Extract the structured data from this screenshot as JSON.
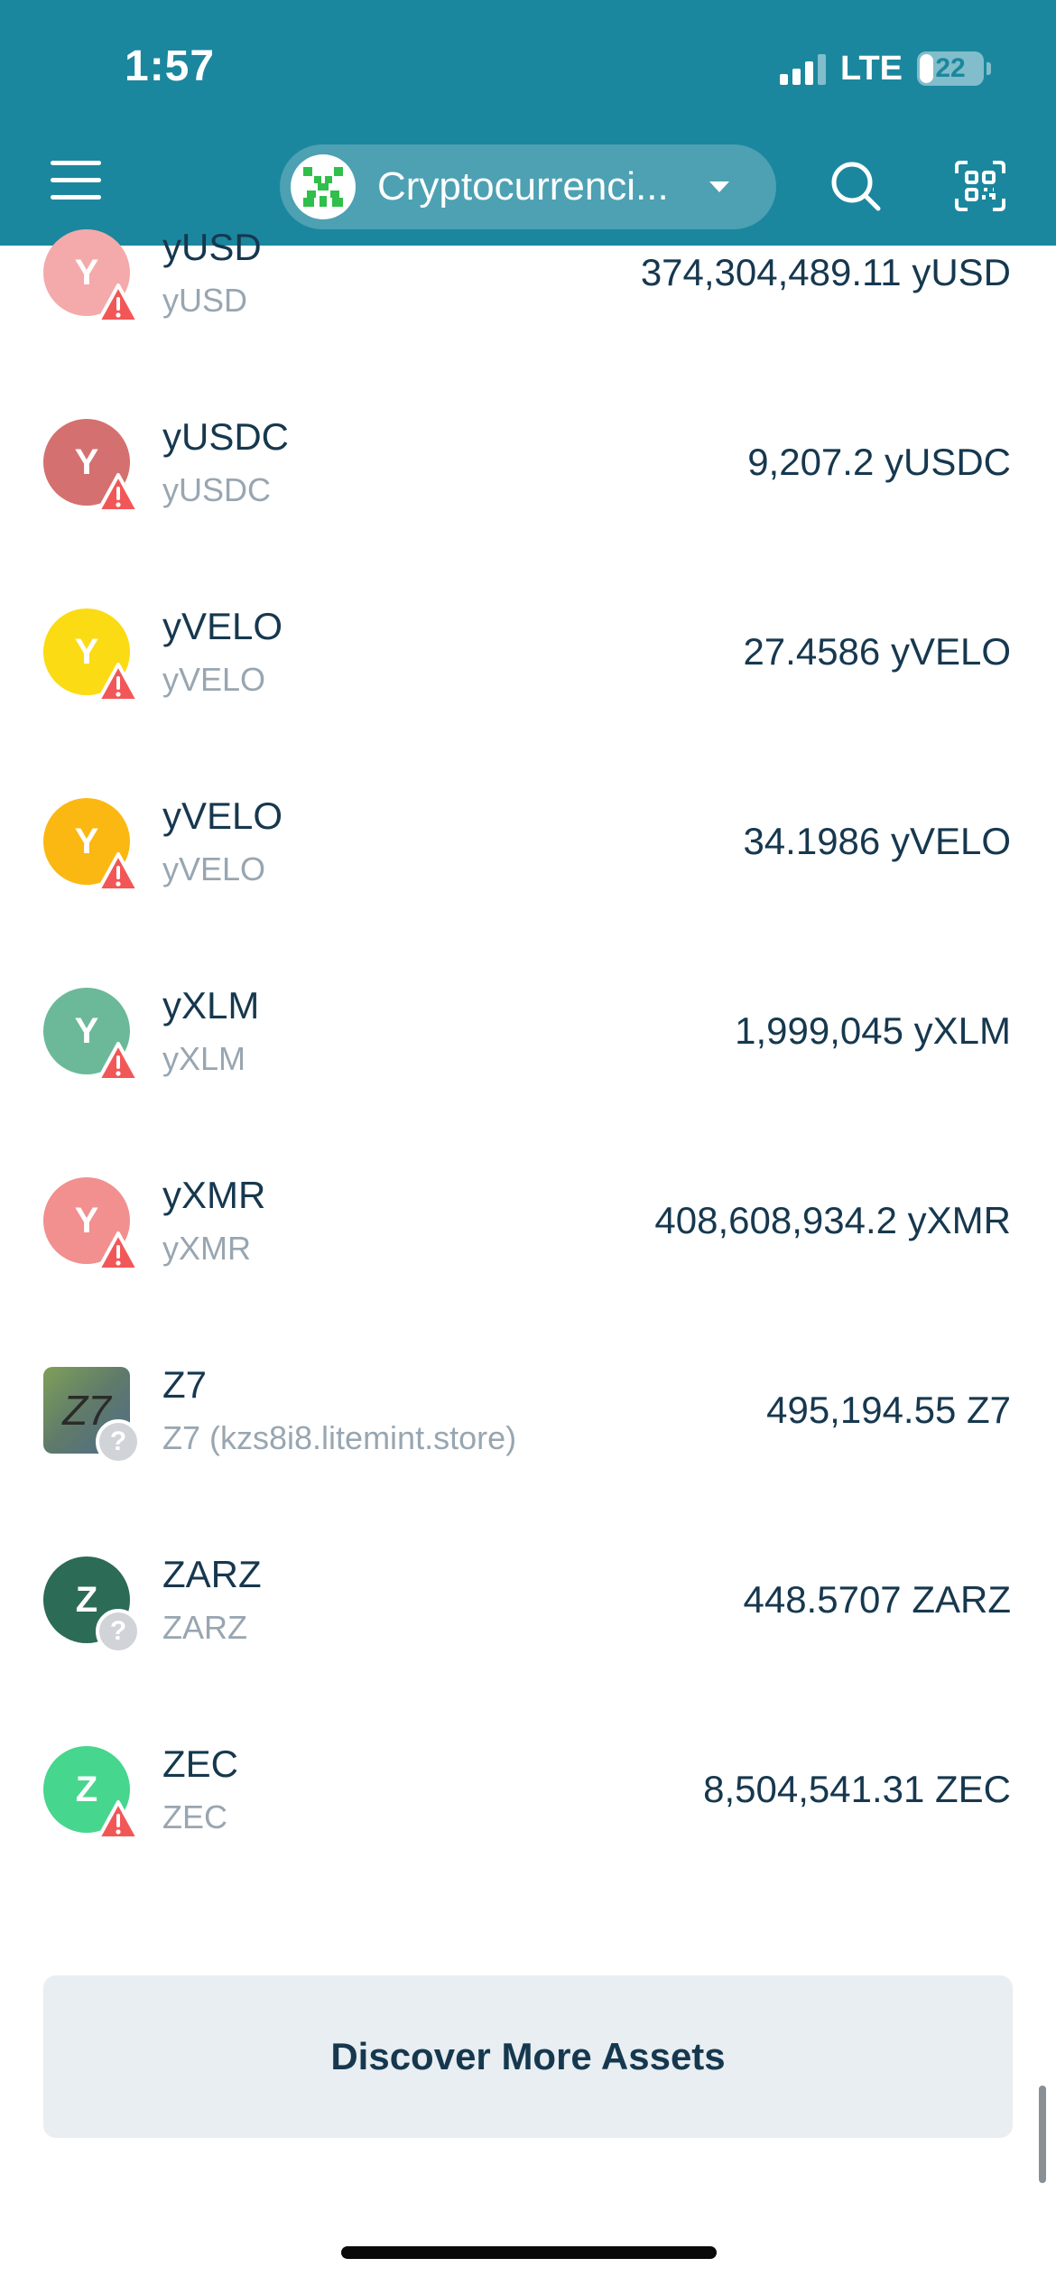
{
  "status_bar": {
    "time": "1:57",
    "network": "LTE",
    "battery": "22",
    "battery_level": 0.22
  },
  "header": {
    "wallet_name": "Cryptocurrenci...",
    "colors": {
      "background": "#1b879e"
    }
  },
  "assets": [
    {
      "code": "yUSD",
      "subtitle": "yUSD",
      "amount": "374,304,489.11 yUSD",
      "icon_letter": "Y",
      "icon_color": "#f4aaaa",
      "badge": "warning-icon"
    },
    {
      "code": "yUSDC",
      "subtitle": "yUSDC",
      "amount": "9,207.2 yUSDC",
      "icon_letter": "Y",
      "icon_color": "#d4706f",
      "badge": "warning-icon"
    },
    {
      "code": "yVELO",
      "subtitle": "yVELO",
      "amount": "27.4586 yVELO",
      "icon_letter": "Y",
      "icon_color": "#fbdb13",
      "badge": "warning-icon"
    },
    {
      "code": "yVELO",
      "subtitle": "yVELO",
      "amount": "34.1986 yVELO",
      "icon_letter": "Y",
      "icon_color": "#fbb813",
      "badge": "warning-icon"
    },
    {
      "code": "yXLM",
      "subtitle": "yXLM",
      "amount": "1,999,045 yXLM",
      "icon_letter": "Y",
      "icon_color": "#6cb99a",
      "badge": "warning-icon"
    },
    {
      "code": "yXMR",
      "subtitle": "yXMR",
      "amount": "408,608,934.2 yXMR",
      "icon_letter": "Y",
      "icon_color": "#f28f8f",
      "badge": "warning-icon"
    },
    {
      "code": "Z7",
      "subtitle": "Z7 (kzs8i8.litemint.store)",
      "amount": "495,194.55 Z7",
      "icon_letter": "Z7",
      "icon_color": "#6f8a68",
      "badge": "question-icon"
    },
    {
      "code": "ZARZ",
      "subtitle": "ZARZ",
      "amount": "448.5707 ZARZ",
      "icon_letter": "Z",
      "icon_color": "#2c6b55",
      "badge": "question-icon"
    },
    {
      "code": "ZEC",
      "subtitle": "ZEC",
      "amount": "8,504,541.31 ZEC",
      "icon_letter": "Z",
      "icon_color": "#46d68e",
      "badge": "warning-icon"
    }
  ],
  "discover_button": {
    "label": "Discover More Assets"
  }
}
